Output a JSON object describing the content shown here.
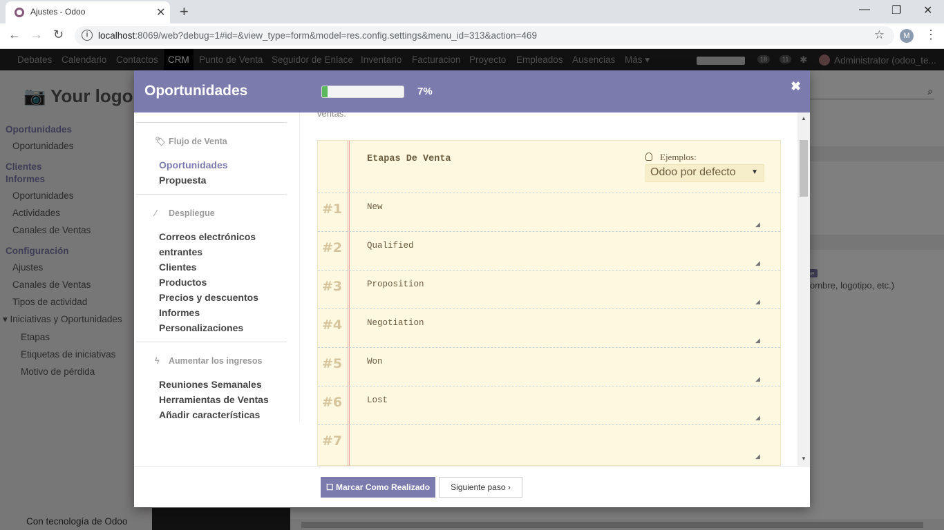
{
  "browser": {
    "tab_title": "Ajustes - Odoo",
    "url_host": "localhost",
    "url_rest": ":8069/web?debug=1#id=&view_type=form&model=res.config.settings&menu_id=313&action=469",
    "profile_initial": "M"
  },
  "odoo_nav": {
    "items": [
      "Debates",
      "Calendario",
      "Contactos",
      "CRM",
      "Punto de Venta",
      "Seguidor de Enlace",
      "Inventario",
      "Facturacion",
      "Proyecto",
      "Empleados",
      "Ausencias",
      "Más"
    ],
    "active": "CRM",
    "badge_messages": "18",
    "badge_activities": "11",
    "user": "Administrator (odoo_te..."
  },
  "sidebar": {
    "logo": "Your logo",
    "sections": [
      {
        "header": "Oportunidades",
        "items": [
          "Oportunidades"
        ]
      },
      {
        "header": "Clientes",
        "items": []
      },
      {
        "header": "Informes",
        "items": [
          "Oportunidades",
          "Actividades",
          "Canales de Ventas"
        ]
      },
      {
        "header": "Configuración",
        "items": [
          "Ajustes",
          "Canales de Ventas",
          "Tipos de actividad",
          "Iniciativas y Oportunidades",
          "Etapas",
          "Etiquetas de iniciativas",
          "Motivo de pérdida"
        ]
      }
    ],
    "footer": "Con tecnología de Odoo"
  },
  "background": {
    "tag": "se",
    "text": "ombre, logotipo, etc.)"
  },
  "modal": {
    "title": "Oportunidades",
    "progress_percent": 7,
    "progress_label": "7%",
    "close_label": "✖",
    "left_nav": {
      "sections": [
        {
          "title": "Flujo de Venta",
          "items": [
            "Oportunidades",
            "Propuesta"
          ]
        },
        {
          "title": "Despliegue",
          "items": [
            "Correos electrónicos",
            "entrantes",
            "Clientes",
            "Productos",
            "Precios y descuentos",
            "Informes",
            "Personalizaciones"
          ]
        },
        {
          "title": "Aumentar los ingresos",
          "items": [
            "Reuniones Semanales",
            "Herramientas de Ventas",
            "Añadir características"
          ]
        }
      ],
      "active_item": "Oportunidades"
    },
    "cut_text": "ventas.",
    "notepad": {
      "title": "Etapas De Venta",
      "examples_label": "Ejemplos:",
      "examples_selected": "Odoo por defecto",
      "rows": [
        {
          "num": "#1",
          "value": "New"
        },
        {
          "num": "#2",
          "value": "Qualified"
        },
        {
          "num": "#3",
          "value": "Proposition"
        },
        {
          "num": "#4",
          "value": "Negotiation"
        },
        {
          "num": "#5",
          "value": "Won"
        },
        {
          "num": "#6",
          "value": "Lost"
        },
        {
          "num": "#7",
          "value": ""
        }
      ]
    },
    "footer": {
      "done_label": "☐ Marcar Como Realizado",
      "next_label": "Siguiente paso  ›"
    }
  }
}
